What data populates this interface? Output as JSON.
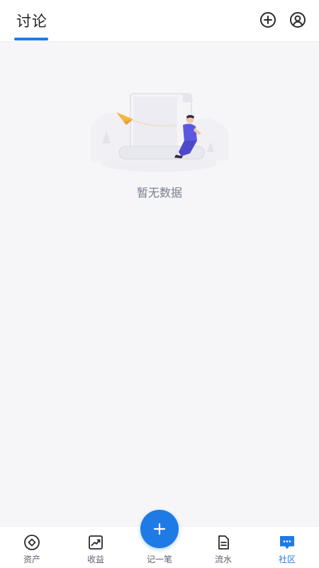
{
  "header": {
    "title": "讨论",
    "add_icon": "plus-circle-icon",
    "user_icon": "user-circle-icon",
    "accent": "#1e7be6"
  },
  "empty_state": {
    "message": "暂无数据",
    "illustration": "empty-scroll-illustration"
  },
  "bottom_nav": {
    "items": [
      {
        "label": "资产",
        "icon": "asset-circle-icon"
      },
      {
        "label": "收益",
        "icon": "trend-chart-icon"
      },
      {
        "label": "记一笔",
        "icon": "plus-icon"
      },
      {
        "label": "流水",
        "icon": "document-icon"
      },
      {
        "label": "社区",
        "icon": "chat-bubble-icon",
        "active": true
      }
    ]
  }
}
